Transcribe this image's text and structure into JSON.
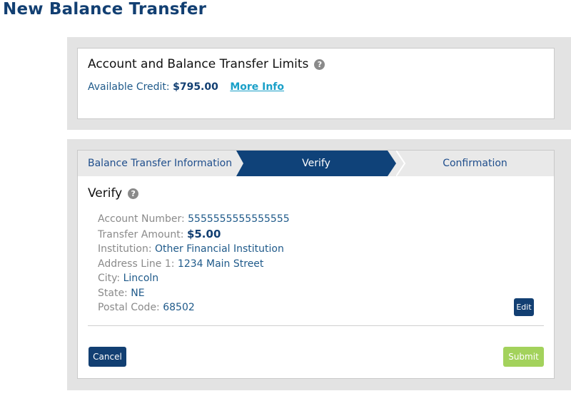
{
  "page": {
    "title": "New Balance Transfer"
  },
  "limits": {
    "heading": "Account and Balance Transfer Limits",
    "help_icon": "?",
    "available_credit_label": "Available Credit:",
    "available_credit_value": "$795.00",
    "more_info": "More Info"
  },
  "stepper": {
    "steps": [
      {
        "label": "Balance Transfer Information",
        "active": false
      },
      {
        "label": "Verify",
        "active": true
      },
      {
        "label": "Confirmation",
        "active": false
      }
    ],
    "active_color": "#0f4279",
    "inactive_color": "#e9e9e9"
  },
  "verify": {
    "heading": "Verify",
    "help_icon": "?",
    "fields": {
      "account_number": {
        "label": "Account Number:",
        "value": "5555555555555555"
      },
      "transfer_amount": {
        "label": "Transfer Amount:",
        "value": "$5.00"
      },
      "institution": {
        "label": "Institution:",
        "value": "Other Financial Institution"
      },
      "address_line_1": {
        "label": "Address Line 1:",
        "value": "1234 Main Street"
      },
      "city": {
        "label": "City:",
        "value": "Lincoln"
      },
      "state": {
        "label": "State:",
        "value": "NE"
      },
      "postal_code": {
        "label": "Postal Code:",
        "value": "68502"
      }
    },
    "edit_label": "Edit"
  },
  "actions": {
    "cancel_label": "Cancel",
    "submit_label": "Submit"
  },
  "colors": {
    "primary": "#123f72",
    "link": "#1aa0c8",
    "submit": "#a3d25c",
    "panel_bg": "#e3e3e3"
  }
}
